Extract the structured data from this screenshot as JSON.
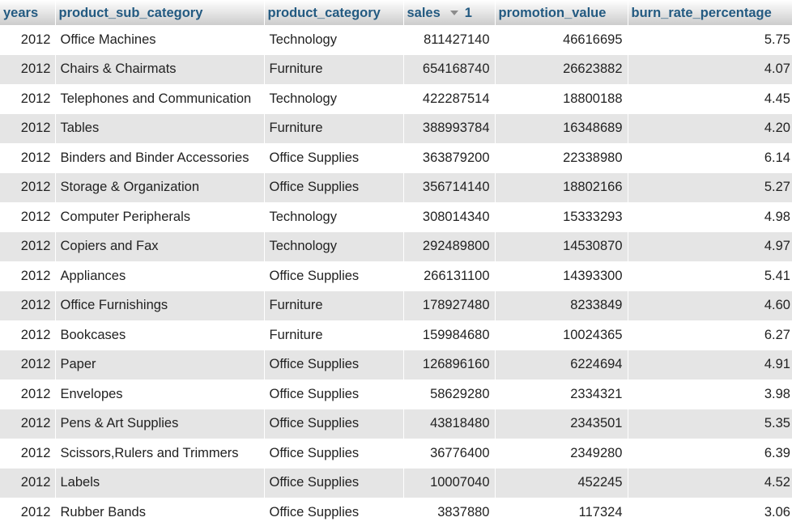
{
  "table": {
    "columns": [
      {
        "key": "years",
        "label": "years"
      },
      {
        "key": "product_sub_category",
        "label": "product_sub_category"
      },
      {
        "key": "product_category",
        "label": "product_category"
      },
      {
        "key": "sales",
        "label": "sales",
        "sort_direction": "descending",
        "sort_order": "1"
      },
      {
        "key": "promotion_value",
        "label": "promotion_value"
      },
      {
        "key": "burn_rate_percentage",
        "label": "burn_rate_percentage"
      }
    ],
    "rows": [
      [
        "2012",
        "Office Machines",
        "Technology",
        "811427140",
        "46616695",
        "5.75"
      ],
      [
        "2012",
        "Chairs & Chairmats",
        "Furniture",
        "654168740",
        "26623882",
        "4.07"
      ],
      [
        "2012",
        "Telephones and Communication",
        "Technology",
        "422287514",
        "18800188",
        "4.45"
      ],
      [
        "2012",
        "Tables",
        "Furniture",
        "388993784",
        "16348689",
        "4.20"
      ],
      [
        "2012",
        "Binders and Binder Accessories",
        "Office Supplies",
        "363879200",
        "22338980",
        "6.14"
      ],
      [
        "2012",
        "Storage & Organization",
        "Office Supplies",
        "356714140",
        "18802166",
        "5.27"
      ],
      [
        "2012",
        "Computer Peripherals",
        "Technology",
        "308014340",
        "15333293",
        "4.98"
      ],
      [
        "2012",
        "Copiers and Fax",
        "Technology",
        "292489800",
        "14530870",
        "4.97"
      ],
      [
        "2012",
        "Appliances",
        "Office Supplies",
        "266131100",
        "14393300",
        "5.41"
      ],
      [
        "2012",
        "Office Furnishings",
        "Furniture",
        "178927480",
        "8233849",
        "4.60"
      ],
      [
        "2012",
        "Bookcases",
        "Furniture",
        "159984680",
        "10024365",
        "6.27"
      ],
      [
        "2012",
        "Paper",
        "Office Supplies",
        "126896160",
        "6224694",
        "4.91"
      ],
      [
        "2012",
        "Envelopes",
        "Office Supplies",
        "58629280",
        "2334321",
        "3.98"
      ],
      [
        "2012",
        "Pens & Art Supplies",
        "Office Supplies",
        "43818480",
        "2343501",
        "5.35"
      ],
      [
        "2012",
        "Scissors,Rulers and Trimmers",
        "Office Supplies",
        "36776400",
        "2349280",
        "6.39"
      ],
      [
        "2012",
        "Labels",
        "Office Supplies",
        "10007040",
        "452245",
        "4.52"
      ],
      [
        "2012",
        "Rubber Bands",
        "Office Supplies",
        "3837880",
        "117324",
        "3.06"
      ]
    ]
  },
  "colors": {
    "header_text": "#235a81",
    "row_odd": "#ffffff",
    "row_even": "#e5e5e5",
    "sort_arrow": "#8c8c8c"
  },
  "icons": {
    "sort": "sort-descending-icon"
  }
}
